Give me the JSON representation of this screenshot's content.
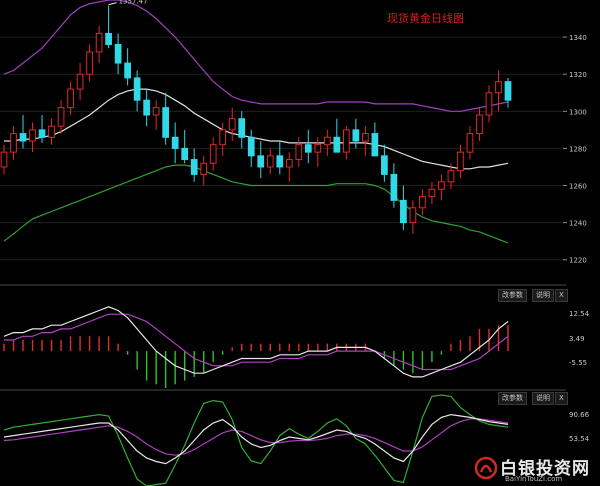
{
  "title": "现货黄金日线图",
  "chart_data": {
    "type": "candlestick",
    "title": "现货黄金日线图",
    "main": {
      "y_ticks": [
        1220,
        1240,
        1260,
        1280,
        1300,
        1320,
        1340
      ],
      "ylim": [
        1208,
        1360
      ],
      "peak_label": "1357.47",
      "peak_value": 1357.47,
      "candles": [
        [
          1270,
          1282,
          1266,
          1278
        ],
        [
          1278,
          1292,
          1274,
          1288
        ],
        [
          1288,
          1298,
          1280,
          1284
        ],
        [
          1284,
          1294,
          1278,
          1290
        ],
        [
          1290,
          1298,
          1283,
          1286
        ],
        [
          1286,
          1296,
          1282,
          1292
        ],
        [
          1292,
          1306,
          1288,
          1302
        ],
        [
          1302,
          1316,
          1298,
          1312
        ],
        [
          1312,
          1326,
          1306,
          1320
        ],
        [
          1320,
          1336,
          1316,
          1332
        ],
        [
          1332,
          1346,
          1326,
          1342
        ],
        [
          1342,
          1357,
          1334,
          1336
        ],
        [
          1336,
          1342,
          1320,
          1326
        ],
        [
          1326,
          1334,
          1314,
          1318
        ],
        [
          1318,
          1322,
          1300,
          1306
        ],
        [
          1306,
          1312,
          1292,
          1298
        ],
        [
          1298,
          1306,
          1290,
          1302
        ],
        [
          1302,
          1310,
          1282,
          1286
        ],
        [
          1286,
          1294,
          1272,
          1280
        ],
        [
          1280,
          1290,
          1272,
          1274
        ],
        [
          1274,
          1280,
          1262,
          1266
        ],
        [
          1266,
          1276,
          1260,
          1272
        ],
        [
          1272,
          1286,
          1268,
          1282
        ],
        [
          1282,
          1294,
          1276,
          1290
        ],
        [
          1290,
          1302,
          1284,
          1296
        ],
        [
          1296,
          1300,
          1280,
          1286
        ],
        [
          1286,
          1290,
          1270,
          1276
        ],
        [
          1276,
          1284,
          1264,
          1270
        ],
        [
          1270,
          1280,
          1266,
          1276
        ],
        [
          1276,
          1284,
          1266,
          1270
        ],
        [
          1270,
          1278,
          1262,
          1274
        ],
        [
          1274,
          1286,
          1270,
          1282
        ],
        [
          1282,
          1290,
          1272,
          1278
        ],
        [
          1278,
          1286,
          1270,
          1282
        ],
        [
          1282,
          1290,
          1276,
          1286
        ],
        [
          1286,
          1296,
          1280,
          1278
        ],
        [
          1278,
          1292,
          1274,
          1290
        ],
        [
          1290,
          1296,
          1280,
          1284
        ],
        [
          1284,
          1292,
          1276,
          1288
        ],
        [
          1288,
          1294,
          1280,
          1276
        ],
        [
          1276,
          1282,
          1262,
          1266
        ],
        [
          1266,
          1272,
          1248,
          1252
        ],
        [
          1252,
          1260,
          1236,
          1240
        ],
        [
          1240,
          1252,
          1234,
          1248
        ],
        [
          1248,
          1258,
          1244,
          1254
        ],
        [
          1254,
          1262,
          1250,
          1258
        ],
        [
          1258,
          1266,
          1252,
          1262
        ],
        [
          1262,
          1272,
          1258,
          1268
        ],
        [
          1268,
          1282,
          1264,
          1278
        ],
        [
          1278,
          1292,
          1274,
          1288
        ],
        [
          1288,
          1302,
          1284,
          1298
        ],
        [
          1298,
          1314,
          1294,
          1310
        ],
        [
          1310,
          1322,
          1300,
          1316
        ],
        [
          1316,
          1318,
          1302,
          1306
        ]
      ],
      "ma": [
        1284,
        1284,
        1285,
        1285,
        1286,
        1287,
        1289,
        1292,
        1295,
        1298,
        1302,
        1306,
        1309,
        1311,
        1312,
        1312,
        1311,
        1309,
        1306,
        1303,
        1299,
        1296,
        1293,
        1290,
        1288,
        1287,
        1286,
        1285,
        1284,
        1284,
        1283,
        1283,
        1283,
        1283,
        1283,
        1283,
        1283,
        1283,
        1283,
        1282,
        1281,
        1279,
        1277,
        1275,
        1273,
        1272,
        1271,
        1270,
        1269,
        1269,
        1270,
        1270,
        1271,
        1272
      ],
      "upper": [
        1320,
        1322,
        1326,
        1330,
        1334,
        1340,
        1346,
        1352,
        1356,
        1358,
        1359,
        1360,
        1360,
        1359,
        1357,
        1354,
        1350,
        1345,
        1340,
        1334,
        1328,
        1322,
        1316,
        1312,
        1308,
        1306,
        1305,
        1304,
        1304,
        1304,
        1304,
        1304,
        1304,
        1304,
        1305,
        1305,
        1305,
        1305,
        1305,
        1304,
        1304,
        1304,
        1304,
        1304,
        1303,
        1302,
        1301,
        1300,
        1300,
        1301,
        1302,
        1303,
        1304,
        1305
      ],
      "lower": [
        1230,
        1234,
        1238,
        1242,
        1244,
        1246,
        1248,
        1250,
        1252,
        1254,
        1256,
        1258,
        1260,
        1262,
        1264,
        1266,
        1268,
        1270,
        1271,
        1271,
        1270,
        1268,
        1266,
        1264,
        1262,
        1261,
        1260,
        1260,
        1260,
        1260,
        1260,
        1260,
        1260,
        1260,
        1260,
        1261,
        1261,
        1261,
        1261,
        1260,
        1258,
        1254,
        1250,
        1246,
        1243,
        1241,
        1240,
        1239,
        1238,
        1236,
        1235,
        1233,
        1231,
        1229
      ]
    },
    "macd": {
      "labels": [
        "12.54",
        "3.49",
        "-5.55"
      ],
      "ylim": [
        -10,
        16
      ],
      "dif": [
        4,
        5,
        5,
        6,
        6,
        7,
        7,
        8,
        9,
        10,
        11,
        12,
        11,
        9,
        6,
        3,
        0,
        -2,
        -4,
        -5,
        -6,
        -6,
        -5,
        -4,
        -3,
        -2,
        -2,
        -2,
        -2,
        -1,
        -1,
        -1,
        0,
        0,
        0,
        1,
        1,
        1,
        1,
        0,
        -2,
        -4,
        -6,
        -7,
        -7,
        -6,
        -5,
        -4,
        -3,
        -1,
        1,
        3,
        6,
        8
      ],
      "dea": [
        3,
        3,
        4,
        4,
        5,
        5,
        6,
        6,
        7,
        8,
        9,
        10,
        10,
        10,
        9,
        8,
        6,
        4,
        2,
        0,
        -2,
        -3,
        -4,
        -4,
        -4,
        -3,
        -3,
        -3,
        -3,
        -2,
        -2,
        -2,
        -1,
        -1,
        -1,
        0,
        0,
        0,
        0,
        0,
        -1,
        -2,
        -3,
        -4,
        -5,
        -5,
        -5,
        -5,
        -4,
        -3,
        -2,
        0,
        2,
        4
      ],
      "hist": [
        2,
        3,
        3,
        3,
        3,
        3,
        3,
        4,
        4,
        4,
        4,
        4,
        2,
        -1,
        -5,
        -8,
        -9,
        -10,
        -9,
        -8,
        -7,
        -6,
        -3,
        -1,
        1,
        2,
        2,
        2,
        2,
        2,
        2,
        2,
        2,
        2,
        2,
        2,
        2,
        2,
        2,
        0,
        -2,
        -4,
        -5,
        -6,
        -5,
        -3,
        -1,
        2,
        3,
        4,
        6,
        6,
        7,
        7
      ]
    },
    "kdj": {
      "labels": [
        "90.66",
        "53.54"
      ],
      "ylim": [
        -10,
        120
      ],
      "k": [
        60,
        62,
        64,
        66,
        68,
        70,
        72,
        74,
        76,
        78,
        80,
        80,
        70,
        55,
        40,
        30,
        25,
        22,
        30,
        40,
        55,
        70,
        80,
        85,
        75,
        60,
        50,
        45,
        48,
        55,
        60,
        58,
        56,
        60,
        65,
        70,
        68,
        62,
        58,
        50,
        40,
        30,
        25,
        40,
        60,
        78,
        88,
        92,
        90,
        88,
        85,
        82,
        80,
        78
      ],
      "d": [
        55,
        56,
        58,
        60,
        62,
        64,
        66,
        68,
        70,
        72,
        74,
        76,
        74,
        68,
        60,
        50,
        42,
        36,
        34,
        36,
        42,
        50,
        58,
        66,
        70,
        68,
        62,
        56,
        52,
        52,
        54,
        55,
        55,
        56,
        58,
        62,
        64,
        64,
        62,
        58,
        52,
        46,
        40,
        40,
        46,
        56,
        66,
        76,
        82,
        86,
        86,
        84,
        82,
        80
      ],
      "j": [
        70,
        74,
        76,
        78,
        80,
        82,
        84,
        86,
        88,
        90,
        92,
        90,
        62,
        30,
        0,
        -10,
        -8,
        -6,
        20,
        48,
        80,
        108,
        112,
        110,
        85,
        45,
        26,
        22,
        40,
        62,
        72,
        64,
        58,
        68,
        80,
        86,
        76,
        58,
        50,
        34,
        16,
        -2,
        -5,
        40,
        88,
        118,
        120,
        118,
        102,
        92,
        83,
        78,
        76,
        74
      ]
    }
  },
  "toolbar": {
    "macd_buttons": [
      "改参数",
      "说明",
      "X"
    ],
    "kdj_buttons": [
      "改参数",
      "说明",
      "X"
    ]
  },
  "watermark": {
    "brand": "白银投资网",
    "url": "BaiYinTouZi.com"
  }
}
